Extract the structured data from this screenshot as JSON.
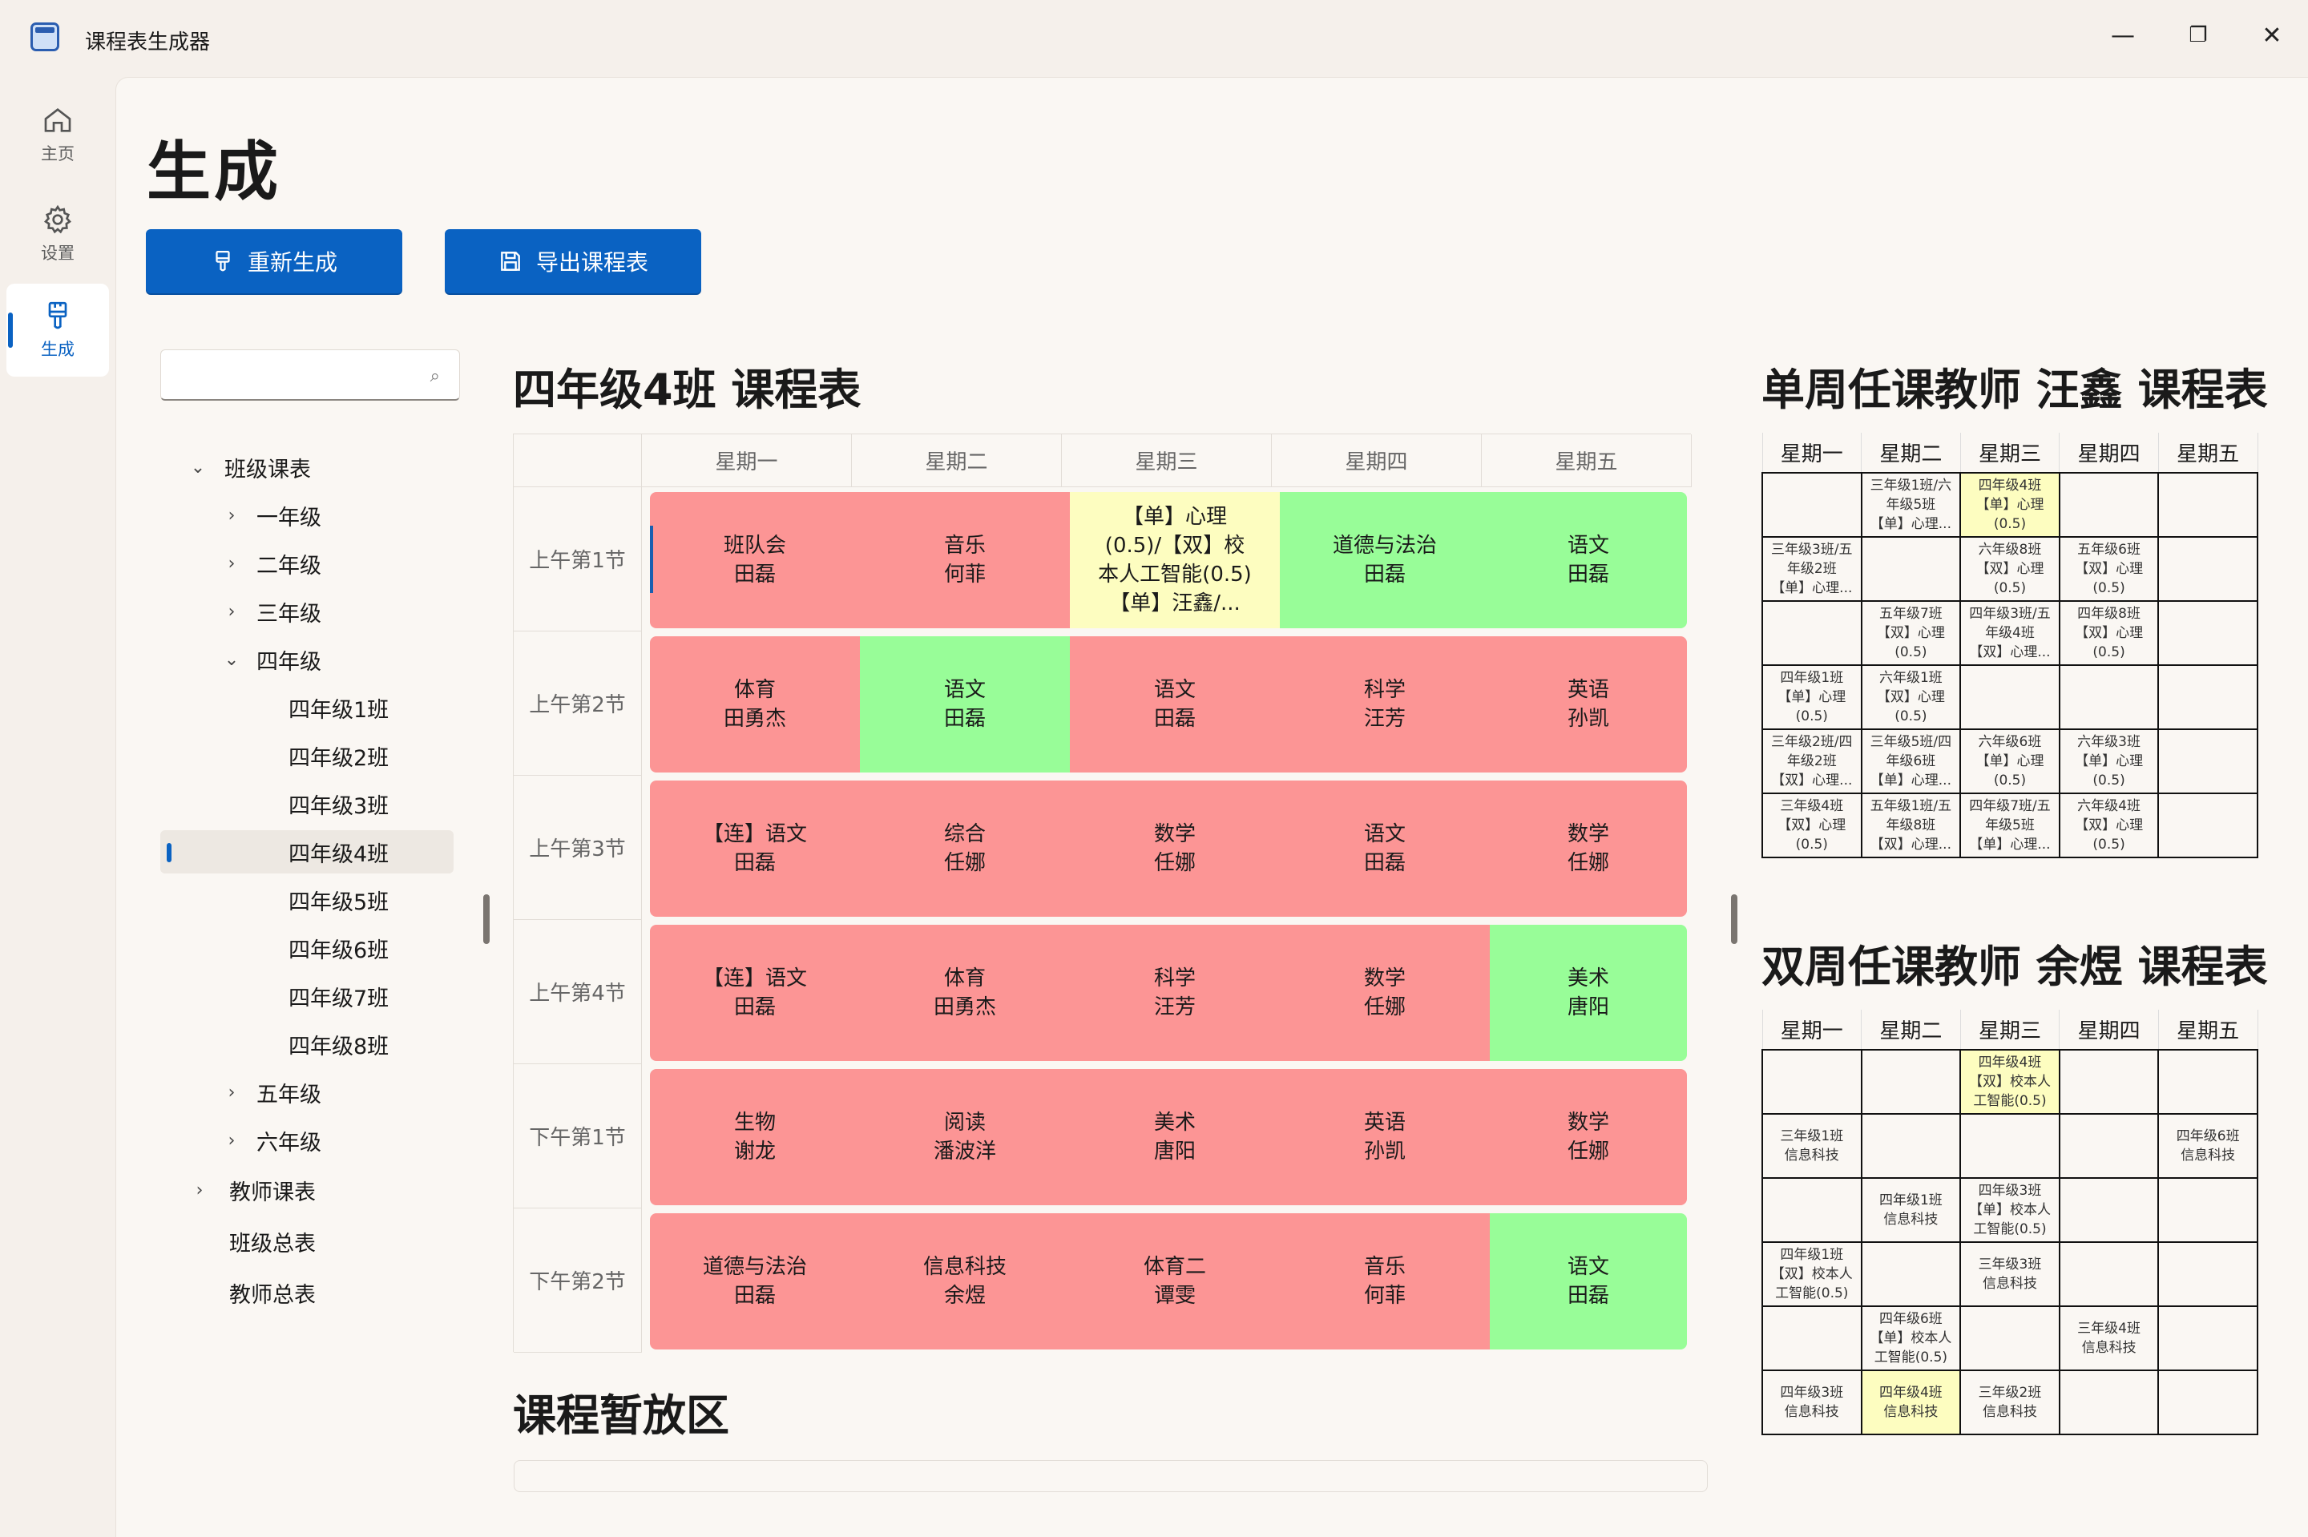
{
  "app": {
    "title": "课程表生成器",
    "minimize": "—",
    "maximize": "❐",
    "close": "✕"
  },
  "nav": [
    {
      "label": "主页",
      "icon": "home-icon"
    },
    {
      "label": "设置",
      "icon": "gear-icon"
    },
    {
      "label": "生成",
      "icon": "brush-icon",
      "active": true
    }
  ],
  "page": {
    "title": "生成"
  },
  "toolbar": {
    "regen_label": "重新生成",
    "export_label": "导出课程表"
  },
  "search": {
    "placeholder": "",
    "icon": "search-icon"
  },
  "tree": {
    "class_schedules": "班级课表",
    "grades": [
      "一年级",
      "二年级",
      "三年级",
      "四年级",
      "五年级",
      "六年级"
    ],
    "grade4_classes": [
      "四年级1班",
      "四年级2班",
      "四年级3班",
      "四年级4班",
      "四年级5班",
      "四年级6班",
      "四年级7班",
      "四年级8班"
    ],
    "selected": "四年级4班",
    "teacher_schedules": "教师课表",
    "class_summary": "班级总表",
    "teacher_summary": "教师总表"
  },
  "main_schedule": {
    "title": "四年级4班 课程表",
    "days": [
      "星期一",
      "星期二",
      "星期三",
      "星期四",
      "星期五"
    ],
    "periods": [
      "上午第1节",
      "上午第2节",
      "上午第3节",
      "上午第4节",
      "下午第1节",
      "下午第2节"
    ],
    "cells": [
      [
        {
          "l1": "班队会",
          "l2": "田磊",
          "l3": "",
          "l4": "",
          "color": "red"
        },
        {
          "l1": "音乐",
          "l2": "何菲",
          "l3": "",
          "l4": "",
          "color": "red"
        },
        {
          "l1": "【单】心理",
          "l2": "(0.5)/【双】校",
          "l3": "本人工智能(0.5)",
          "l4": "【单】汪鑫/...",
          "color": "yellow"
        },
        {
          "l1": "道德与法治",
          "l2": "田磊",
          "l3": "",
          "l4": "",
          "color": "green"
        },
        {
          "l1": "语文",
          "l2": "田磊",
          "l3": "",
          "l4": "",
          "color": "green"
        }
      ],
      [
        {
          "l1": "体育",
          "l2": "田勇杰",
          "l3": "",
          "l4": "",
          "color": "red"
        },
        {
          "l1": "语文",
          "l2": "田磊",
          "l3": "",
          "l4": "",
          "color": "green"
        },
        {
          "l1": "语文",
          "l2": "田磊",
          "l3": "",
          "l4": "",
          "color": "red"
        },
        {
          "l1": "科学",
          "l2": "汪芳",
          "l3": "",
          "l4": "",
          "color": "red"
        },
        {
          "l1": "英语",
          "l2": "孙凯",
          "l3": "",
          "l4": "",
          "color": "red"
        }
      ],
      [
        {
          "l1": "【连】语文",
          "l2": "田磊",
          "l3": "",
          "l4": "",
          "color": "red"
        },
        {
          "l1": "综合",
          "l2": "任娜",
          "l3": "",
          "l4": "",
          "color": "red"
        },
        {
          "l1": "数学",
          "l2": "任娜",
          "l3": "",
          "l4": "",
          "color": "red"
        },
        {
          "l1": "语文",
          "l2": "田磊",
          "l3": "",
          "l4": "",
          "color": "red"
        },
        {
          "l1": "数学",
          "l2": "任娜",
          "l3": "",
          "l4": "",
          "color": "red"
        }
      ],
      [
        {
          "l1": "【连】语文",
          "l2": "田磊",
          "l3": "",
          "l4": "",
          "color": "red"
        },
        {
          "l1": "体育",
          "l2": "田勇杰",
          "l3": "",
          "l4": "",
          "color": "red"
        },
        {
          "l1": "科学",
          "l2": "汪芳",
          "l3": "",
          "l4": "",
          "color": "red"
        },
        {
          "l1": "数学",
          "l2": "任娜",
          "l3": "",
          "l4": "",
          "color": "red"
        },
        {
          "l1": "美术",
          "l2": "唐阳",
          "l3": "",
          "l4": "",
          "color": "green"
        }
      ],
      [
        {
          "l1": "生物",
          "l2": "谢龙",
          "l3": "",
          "l4": "",
          "color": "red"
        },
        {
          "l1": "阅读",
          "l2": "潘波洋",
          "l3": "",
          "l4": "",
          "color": "red"
        },
        {
          "l1": "美术",
          "l2": "唐阳",
          "l3": "",
          "l4": "",
          "color": "red"
        },
        {
          "l1": "英语",
          "l2": "孙凯",
          "l3": "",
          "l4": "",
          "color": "red"
        },
        {
          "l1": "数学",
          "l2": "任娜",
          "l3": "",
          "l4": "",
          "color": "red"
        }
      ],
      [
        {
          "l1": "道德与法治",
          "l2": "田磊",
          "l3": "",
          "l4": "",
          "color": "red"
        },
        {
          "l1": "信息科技",
          "l2": "余煜",
          "l3": "",
          "l4": "",
          "color": "red"
        },
        {
          "l1": "体育二",
          "l2": "谭雯",
          "l3": "",
          "l4": "",
          "color": "red"
        },
        {
          "l1": "音乐",
          "l2": "何菲",
          "l3": "",
          "l4": "",
          "color": "red"
        },
        {
          "l1": "语文",
          "l2": "田磊",
          "l3": "",
          "l4": "",
          "color": "green"
        }
      ]
    ]
  },
  "holding_area": {
    "title": "课程暂放区"
  },
  "single_week": {
    "title": "单周任课教师 汪鑫 课程表",
    "days": [
      "星期一",
      "星期二",
      "星期三",
      "星期四",
      "星期五"
    ],
    "rows": [
      [
        [
          "",
          "",
          ""
        ],
        [
          "三年级1班/六",
          "年级5班",
          "【单】心理..."
        ],
        [
          "四年级4班",
          "【单】心理",
          "(0.5)"
        ],
        [
          "",
          "",
          ""
        ],
        [
          "",
          "",
          ""
        ]
      ],
      [
        [
          "三年级3班/五",
          "年级2班",
          "【单】心理..."
        ],
        [
          "",
          "",
          ""
        ],
        [
          "六年级8班",
          "【双】心理",
          "(0.5)"
        ],
        [
          "五年级6班",
          "【双】心理",
          "(0.5)"
        ],
        [
          "",
          "",
          ""
        ]
      ],
      [
        [
          "",
          "",
          ""
        ],
        [
          "五年级7班",
          "【双】心理",
          "(0.5)"
        ],
        [
          "四年级3班/五",
          "年级4班",
          "【双】心理..."
        ],
        [
          "四年级8班",
          "【双】心理",
          "(0.5)"
        ],
        [
          "",
          "",
          ""
        ]
      ],
      [
        [
          "四年级1班",
          "【单】心理",
          "(0.5)"
        ],
        [
          "六年级1班",
          "【双】心理",
          "(0.5)"
        ],
        [
          "",
          "",
          ""
        ],
        [
          "",
          "",
          ""
        ],
        [
          "",
          "",
          ""
        ]
      ],
      [
        [
          "三年级2班/四",
          "年级2班",
          "【双】心理..."
        ],
        [
          "三年级5班/四",
          "年级6班",
          "【单】心理..."
        ],
        [
          "六年级6班",
          "【单】心理",
          "(0.5)"
        ],
        [
          "六年级3班",
          "【单】心理",
          "(0.5)"
        ],
        [
          "",
          "",
          ""
        ]
      ],
      [
        [
          "三年级4班",
          "【双】心理",
          "(0.5)"
        ],
        [
          "五年级1班/五",
          "年级8班",
          "【双】心理..."
        ],
        [
          "四年级7班/五",
          "年级5班",
          "【单】心理..."
        ],
        [
          "六年级4班",
          "【双】心理",
          "(0.5)"
        ],
        [
          "",
          "",
          ""
        ]
      ]
    ]
  },
  "double_week": {
    "title": "双周任课教师 余煜 课程表",
    "days": [
      "星期一",
      "星期二",
      "星期三",
      "星期四",
      "星期五"
    ],
    "rows": [
      [
        [
          "",
          "",
          ""
        ],
        [
          "",
          "",
          ""
        ],
        [
          "四年级4班",
          "【双】校本人",
          "工智能(0.5)"
        ],
        [
          "",
          "",
          ""
        ],
        [
          "",
          "",
          ""
        ]
      ],
      [
        [
          "三年级1班",
          "信息科技",
          ""
        ],
        [
          "",
          "",
          ""
        ],
        [
          "",
          "",
          ""
        ],
        [
          "",
          "",
          ""
        ],
        [
          "四年级6班",
          "信息科技",
          ""
        ]
      ],
      [
        [
          "",
          "",
          ""
        ],
        [
          "四年级1班",
          "信息科技",
          ""
        ],
        [
          "四年级3班",
          "【单】校本人",
          "工智能(0.5)"
        ],
        [
          "",
          "",
          ""
        ],
        [
          "",
          "",
          ""
        ]
      ],
      [
        [
          "四年级1班",
          "【双】校本人",
          "工智能(0.5)"
        ],
        [
          "",
          "",
          ""
        ],
        [
          "三年级3班",
          "信息科技",
          ""
        ],
        [
          "",
          "",
          ""
        ],
        [
          "",
          "",
          ""
        ]
      ],
      [
        [
          "",
          "",
          ""
        ],
        [
          "四年级6班",
          "【单】校本人",
          "工智能(0.5)"
        ],
        [
          "",
          "",
          ""
        ],
        [
          "三年级4班",
          "信息科技",
          ""
        ],
        [
          "",
          "",
          ""
        ]
      ],
      [
        [
          "四年级3班",
          "信息科技",
          ""
        ],
        [
          "四年级4班",
          "信息科技",
          ""
        ],
        [
          "三年级2班",
          "信息科技",
          ""
        ],
        [
          "",
          "",
          ""
        ],
        [
          "",
          "",
          ""
        ]
      ]
    ]
  },
  "colors": {
    "accent": "#0a62c2",
    "conflict": "#fc9595",
    "ok": "#98fd98",
    "partial": "#fdfdc0"
  }
}
